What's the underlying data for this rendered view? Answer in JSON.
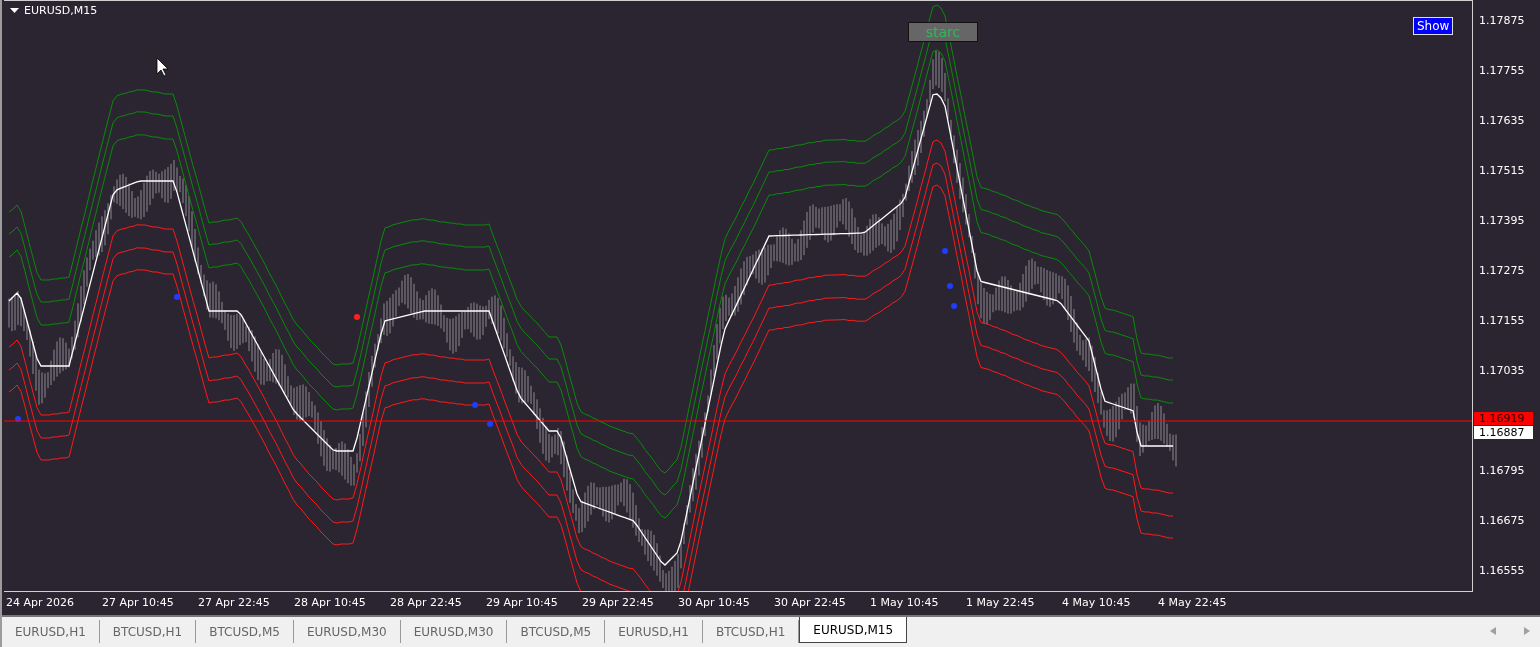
{
  "chart": {
    "title": "EURUSD,M15",
    "indicator_label": "starc",
    "show_button": "Show",
    "price_axis": [
      "1.17875",
      "1.17755",
      "1.17635",
      "1.17515",
      "1.17395",
      "1.17275",
      "1.17155",
      "1.17035",
      "1.16795",
      "1.16675",
      "1.16555"
    ],
    "bid_price": "1.16919",
    "ask_price": "1.16887",
    "time_axis": [
      "24 Apr 2026",
      "27 Apr 10:45",
      "27 Apr 22:45",
      "28 Apr 10:45",
      "28 Apr 22:45",
      "29 Apr 10:45",
      "29 Apr 22:45",
      "30 Apr 10:45",
      "30 Apr 22:45",
      "1 May 10:45",
      "1 May 22:45",
      "4 May 10:45",
      "4 May 22:45"
    ]
  },
  "tabs": [
    {
      "label": "EURUSD,H1",
      "selected": false
    },
    {
      "label": "BTCUSD,H1",
      "selected": false
    },
    {
      "label": "BTCUSD,M5",
      "selected": false
    },
    {
      "label": "EURUSD,M30",
      "selected": false
    },
    {
      "label": "EURUSD,M30",
      "selected": false
    },
    {
      "label": "BTCUSD,M5",
      "selected": false
    },
    {
      "label": "EURUSD,H1",
      "selected": false
    },
    {
      "label": "BTCUSD,H1",
      "selected": false
    },
    {
      "label": "EURUSD,M15",
      "selected": true
    }
  ]
}
